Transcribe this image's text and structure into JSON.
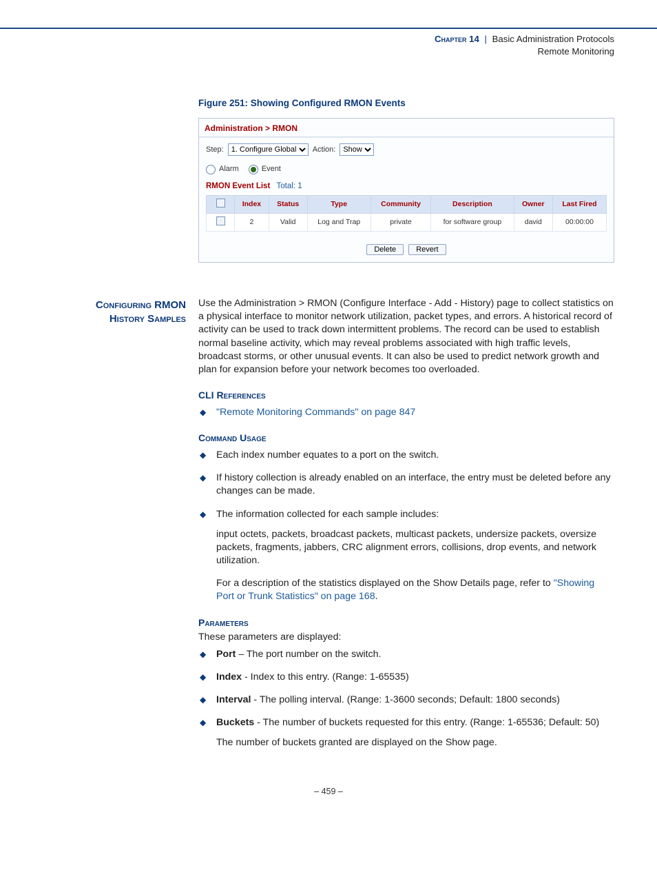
{
  "header": {
    "chapter_label": "Chapter 14",
    "separator": "|",
    "title": "Basic Administration Protocols",
    "subtitle": "Remote Monitoring"
  },
  "figure": {
    "caption": "Figure 251:  Showing Configured RMON Events",
    "breadcrumb": "Administration > RMON",
    "step_label": "Step:",
    "step_value": "1. Configure Global",
    "action_label": "Action:",
    "action_value": "Show",
    "radio_alarm": "Alarm",
    "radio_event": "Event",
    "list_title": "RMON Event List",
    "list_total_label": "Total:",
    "list_total": "1",
    "columns": [
      "",
      "Index",
      "Status",
      "Type",
      "Community",
      "Description",
      "Owner",
      "Last Fired"
    ],
    "row": [
      "",
      "2",
      "Valid",
      "Log and Trap",
      "private",
      "for software group",
      "david",
      "00:00:00"
    ],
    "btn_delete": "Delete",
    "btn_revert": "Revert"
  },
  "section": {
    "side_line1": "Configuring RMON",
    "side_line2": "History Samples",
    "intro": "Use the Administration > RMON (Configure Interface - Add - History) page to collect statistics on a physical interface to monitor network utilization, packet types, and errors. A historical record of activity can be used to track down intermittent problems. The record can be used to establish normal baseline activity, which may reveal problems associated with high traffic levels, broadcast storms, or other unusual events. It can also be used to predict network growth and plan for expansion before your network becomes too overloaded."
  },
  "cli": {
    "heading": "CLI References",
    "link_text": "\"Remote Monitoring Commands\" on page 847"
  },
  "usage": {
    "heading": "Command Usage",
    "item1": "Each index number equates to a port on the switch.",
    "item2": "If history collection is already enabled on an interface, the entry must be deleted before any changes can be made.",
    "item3_lead": "The information collected for each sample includes:",
    "item3_body": "input octets, packets, broadcast packets, multicast packets, undersize packets, oversize packets, fragments, jabbers, CRC alignment errors, collisions, drop events, and network utilization.",
    "item3_ref_lead": "For a description of the statistics displayed on the Show Details page, refer to ",
    "item3_ref_link": "\"Showing Port or Trunk Statistics\" on page 168",
    "item3_ref_tail": "."
  },
  "params": {
    "heading": "Parameters",
    "intro": "These parameters are displayed:",
    "p1_name": "Port",
    "p1_desc": " – The port number on the switch.",
    "p2_name": "Index",
    "p2_desc": " - Index to this entry. (Range: 1-65535)",
    "p3_name": "Interval",
    "p3_desc": " - The polling interval. (Range: 1-3600 seconds; Default: 1800 seconds)",
    "p4_name": "Buckets",
    "p4_desc": " - The number of buckets requested for this entry. (Range: 1-65536; Default: 50)",
    "p4_note": "The number of buckets granted are displayed on the Show page."
  },
  "footer": {
    "text": "–  459  –"
  }
}
